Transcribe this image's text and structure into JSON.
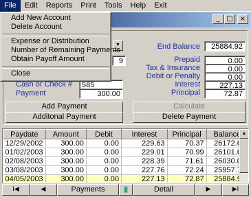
{
  "menubar": {
    "items": [
      "File",
      "Edit",
      "Reports",
      "Print",
      "Tools",
      "Help",
      "Exit"
    ]
  },
  "file_menu": {
    "items": [
      {
        "label": "Add New Account"
      },
      {
        "label": "Delete Account"
      },
      {
        "label": "Expense or Distribution"
      },
      {
        "label": "Number of Remaining Payments"
      },
      {
        "label": "Obtain Payoff Amount"
      },
      {
        "label": "Close"
      }
    ]
  },
  "window": {
    "minimize": "_",
    "maximize": "□",
    "close": "×"
  },
  "form": {
    "partial_value": "9",
    "cash_or_check_label": "Cash or Check #",
    "cash_or_check_value": "585",
    "payment_label": "Payment",
    "payment_value": "300.00",
    "end_balance_label": "End Balance",
    "end_balance_value": "25884.92",
    "prepaid_label": "Prepaid",
    "prepaid_value": "0.00",
    "tax_insurance_label": "Tax & Insurance",
    "tax_insurance_value": "0.00",
    "debit_penalty_label": "Debit or Penalty",
    "debit_penalty_value": "0.00",
    "interest_label": "Interest",
    "interest_value": "227.13",
    "principal_label": "Principal",
    "principal_value": "72.87"
  },
  "buttons": {
    "add_payment": "Add Payment",
    "additional_payment": "Additonal Payment",
    "calculate": "Calculate",
    "delete_payment": "Delete Payment"
  },
  "grid": {
    "columns": [
      "Paydate",
      "Amount",
      "Debit",
      "Interest",
      "Principal",
      "Balance"
    ],
    "rows": [
      [
        "12/29/2002",
        "300.00",
        "0.00",
        "229.63",
        "70.37",
        "26172.63"
      ],
      [
        "01/02/2003",
        "300.00",
        "0.00",
        "229.01",
        "70.99",
        "26101.64"
      ],
      [
        "02/08/2003",
        "300.00",
        "0.00",
        "228.39",
        "71.61",
        "26030.03"
      ],
      [
        "03/08/2003",
        "300.00",
        "0.00",
        "227.76",
        "72.24",
        "25957.79"
      ],
      [
        "04/05/2003",
        "300.00",
        "0.00",
        "227.13",
        "72.87",
        "25884.92"
      ]
    ]
  },
  "navigator": {
    "first": "I◀",
    "prev": "◀",
    "payments": "Payments",
    "detail": "Detail",
    "next": "▶",
    "last": "▶I"
  },
  "colors": {
    "label_blue": "#1c2fa8",
    "highlight_row": "#ffffc0",
    "menu_highlight": "#0a246a"
  }
}
